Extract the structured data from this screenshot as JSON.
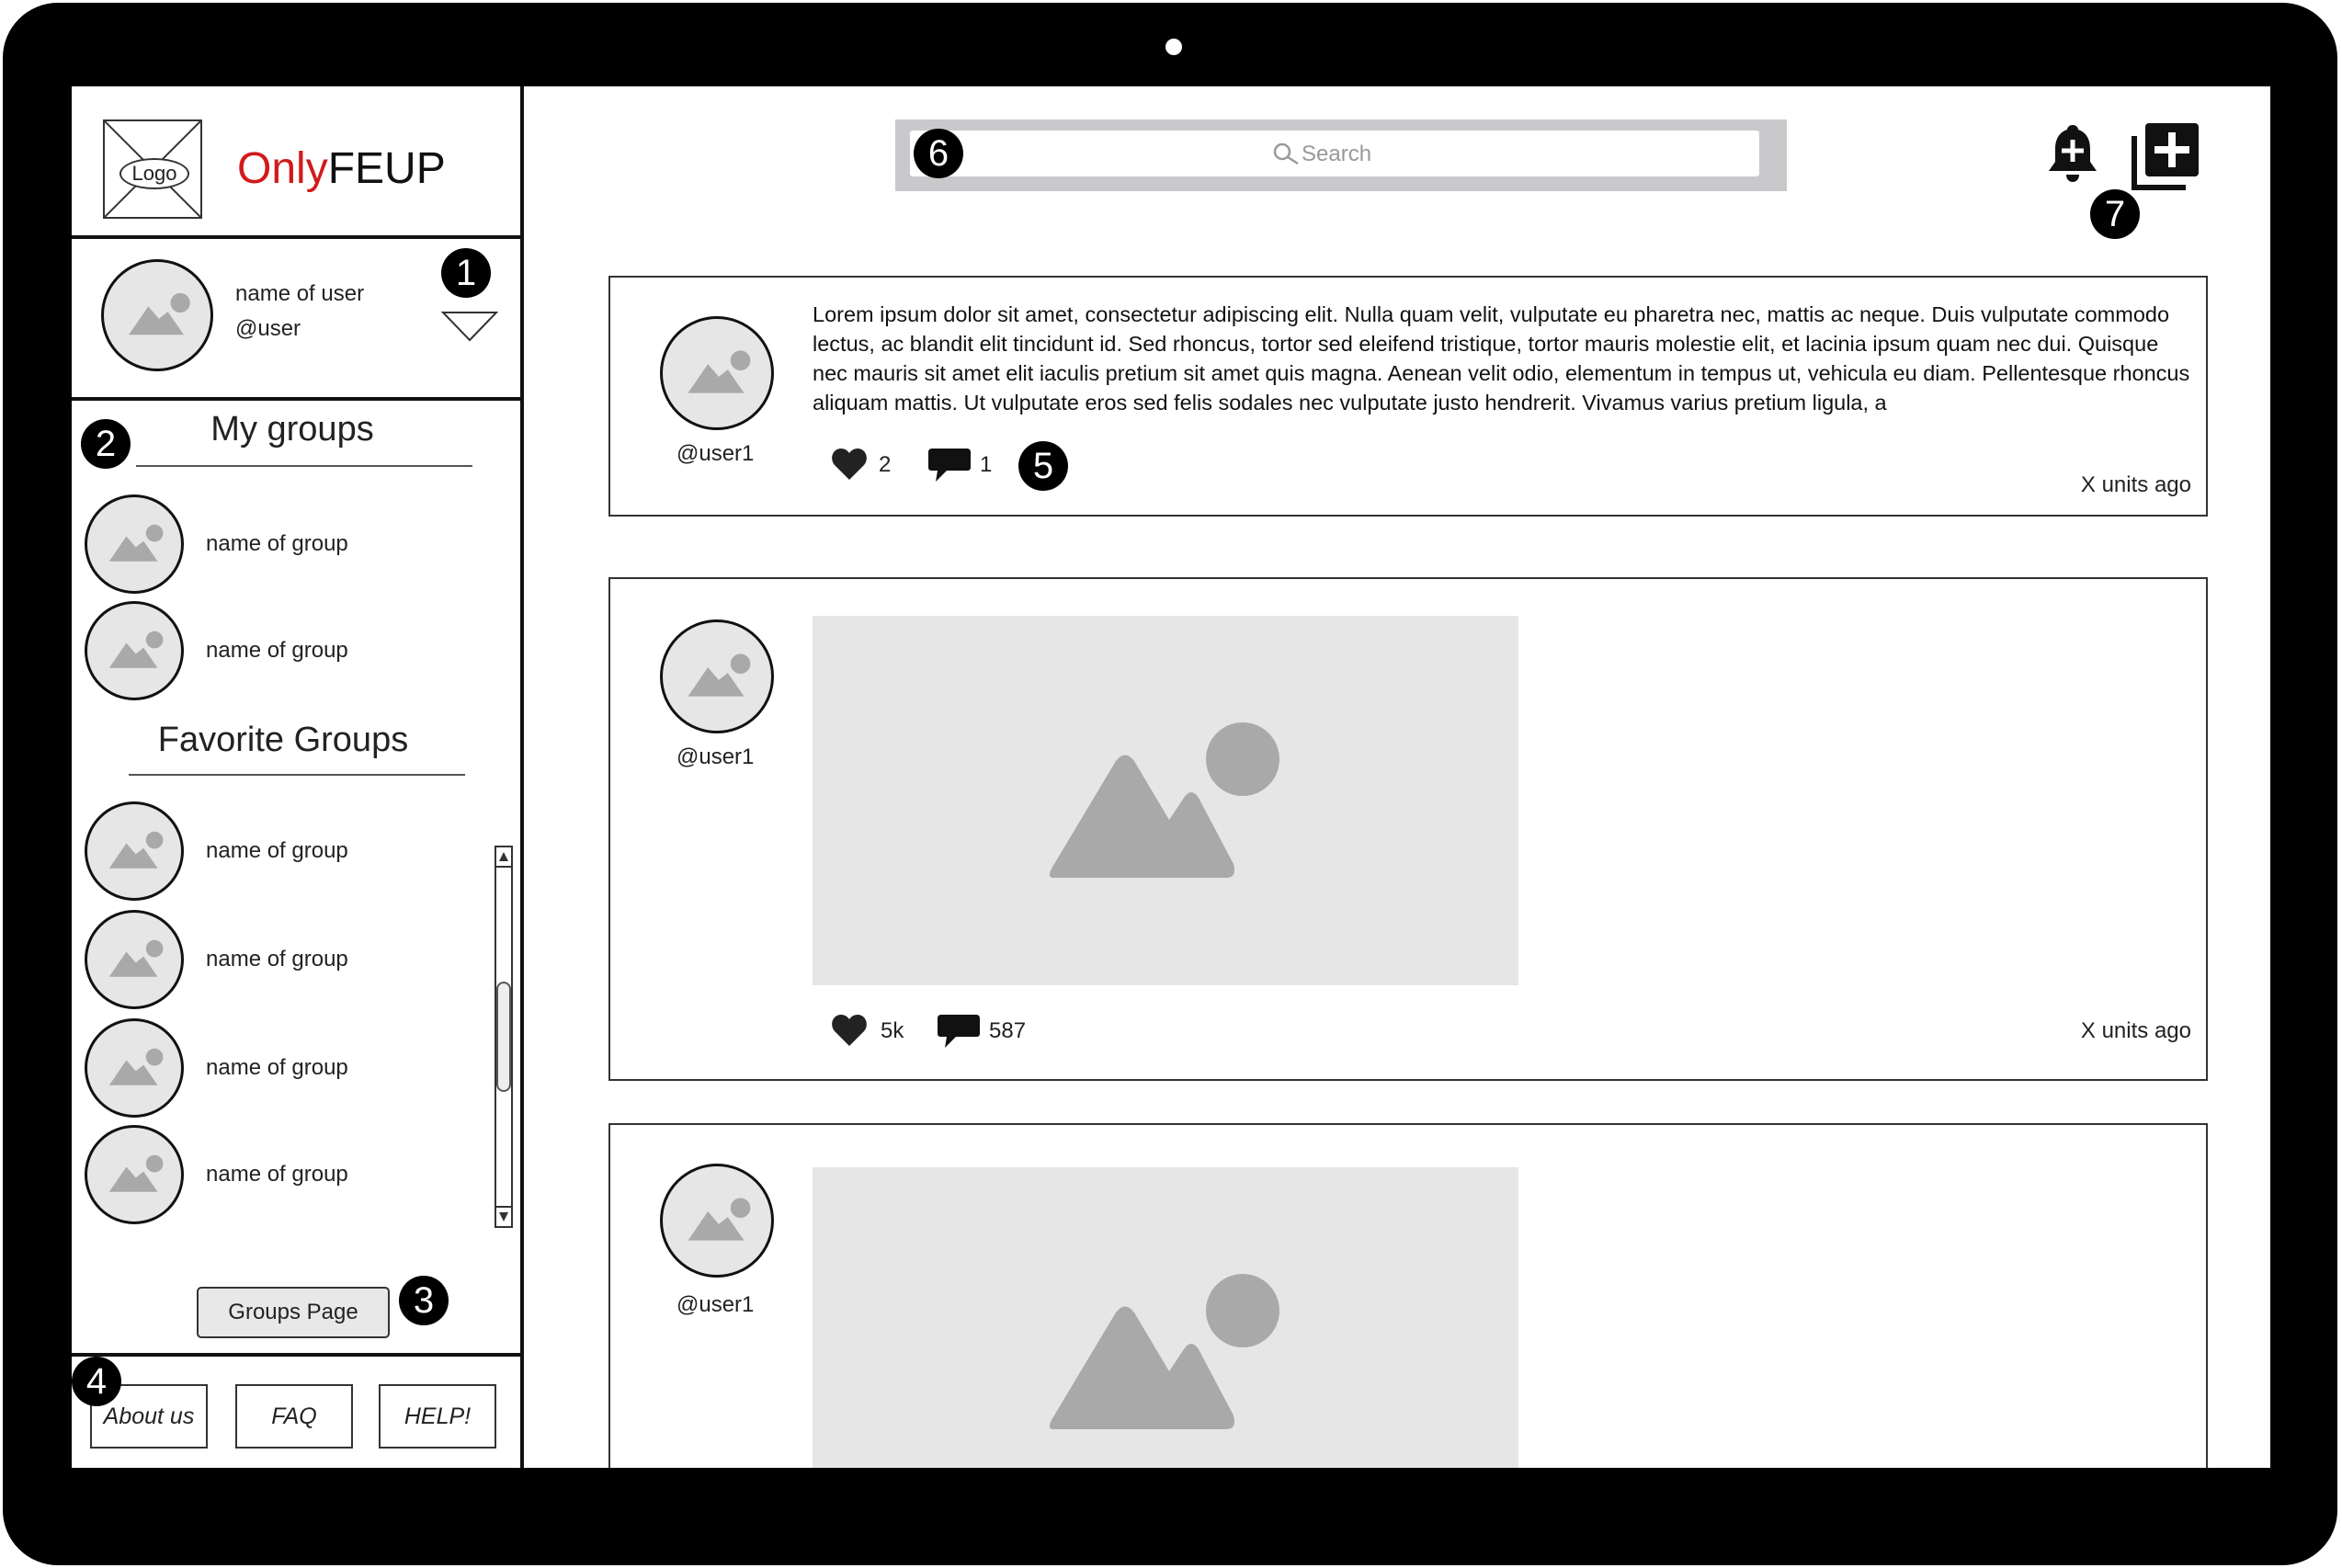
{
  "brand": {
    "logo_label": "Logo",
    "name_part1": "Only",
    "name_part2": "FEUP"
  },
  "user": {
    "name": "name of user",
    "handle": "@user"
  },
  "sidebar": {
    "my_groups_title": "My groups",
    "my_groups": [
      {
        "name": "name of group"
      },
      {
        "name": "name of group"
      }
    ],
    "favorite_groups_title": "Favorite Groups",
    "favorite_groups": [
      {
        "name": "name of group"
      },
      {
        "name": "name of group"
      },
      {
        "name": "name of group"
      },
      {
        "name": "name of group"
      }
    ],
    "groups_page_button": "Groups Page"
  },
  "footer": {
    "about": "About us",
    "faq": "FAQ",
    "help": "HELP!"
  },
  "search": {
    "placeholder": "Search"
  },
  "markers": {
    "m1": "1",
    "m2": "2",
    "m3": "3",
    "m4": "4",
    "m5": "5",
    "m6": "6",
    "m7": "7"
  },
  "posts": [
    {
      "handle": "@user1",
      "text": "Lorem ipsum dolor sit amet, consectetur adipiscing elit. Nulla quam velit, vulputate eu pharetra nec, mattis ac neque. Duis vulputate commodo lectus, ac blandit elit tincidunt id. Sed rhoncus, tortor sed eleifend tristique, tortor mauris molestie elit, et lacinia ipsum quam nec dui. Quisque nec mauris sit amet elit iaculis pretium sit amet quis magna. Aenean velit odio, elementum in tempus ut, vehicula eu diam. Pellentesque rhoncus aliquam mattis. Ut vulputate eros sed felis sodales nec vulputate justo hendrerit. Vivamus varius pretium ligula, a",
      "likes": "2",
      "comments": "1",
      "time": "X units ago"
    },
    {
      "handle": "@user1",
      "likes": "5k",
      "comments": "587",
      "time": "X units ago"
    },
    {
      "handle": "@user1"
    }
  ],
  "icons": {
    "notification": "bell-plus-icon",
    "create": "add-post-icon",
    "like": "heart-icon",
    "comment": "comment-icon",
    "search": "search-icon",
    "placeholder": "image-placeholder-icon"
  }
}
